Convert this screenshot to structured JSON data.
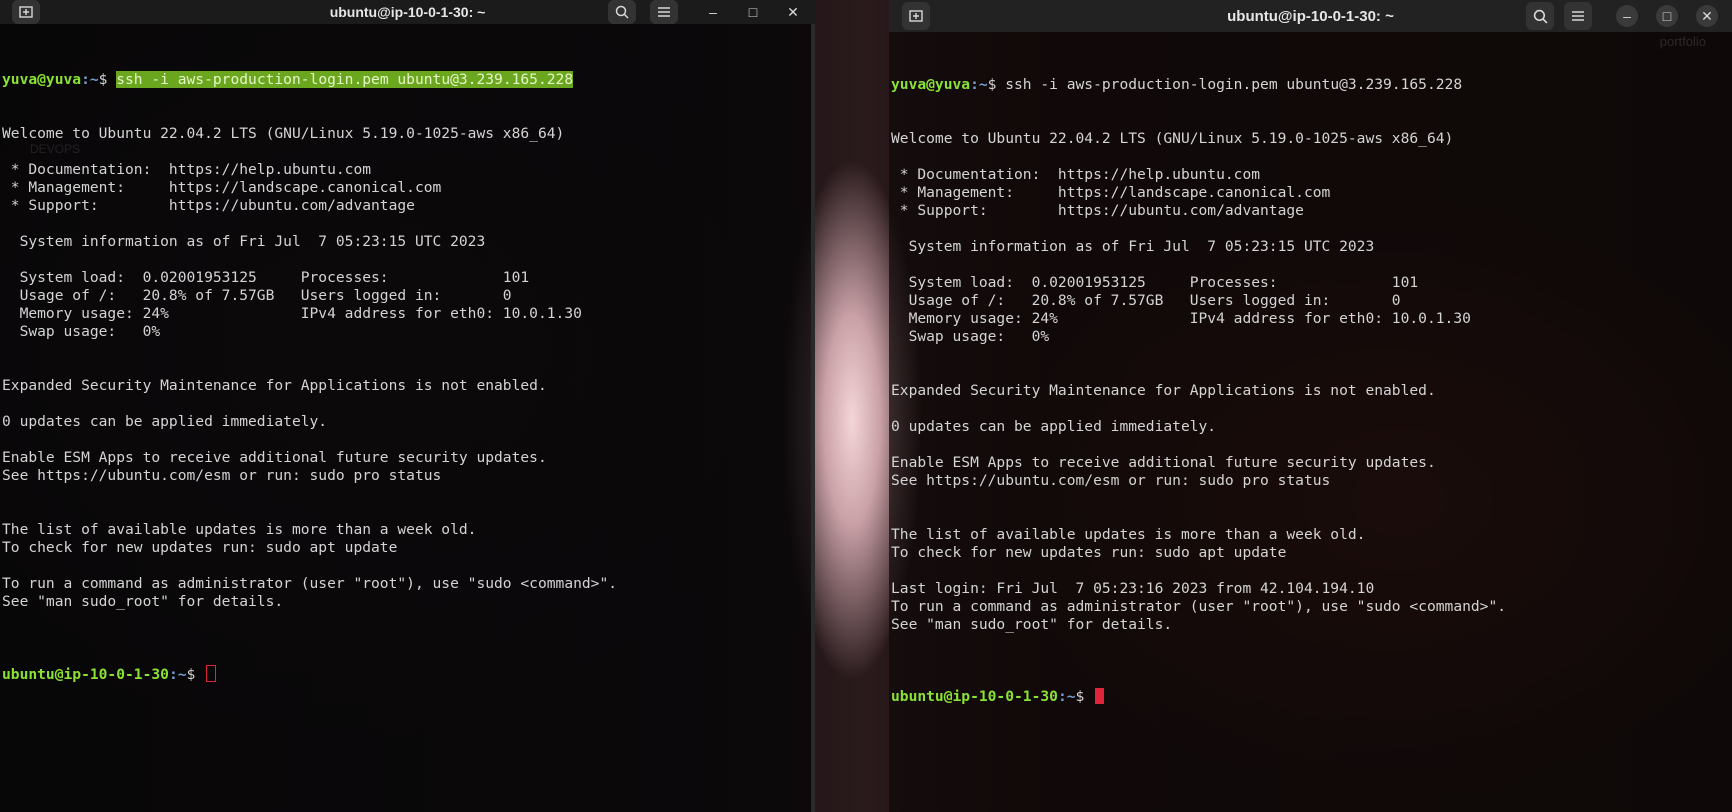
{
  "left_terminal": {
    "title": "ubuntu@ip-10-0-1-30: ~",
    "buttons": {
      "new_tab_icon": "new-tab-icon",
      "search_icon": "search-icon",
      "menu_icon": "hamburger-menu-icon",
      "minimize": "–",
      "maximize": "□",
      "close": "✕"
    },
    "watermark": "DEVOPS",
    "prompt_local_user": "yuva@yuva",
    "prompt_local_path": ":~",
    "prompt_local_symbol": "$ ",
    "command": "ssh -i aws-production-login.pem ubuntu@3.239.165.228",
    "lines": [
      "Welcome to Ubuntu 22.04.2 LTS (GNU/Linux 5.19.0-1025-aws x86_64)",
      "",
      " * Documentation:  https://help.ubuntu.com",
      " * Management:     https://landscape.canonical.com",
      " * Support:        https://ubuntu.com/advantage",
      "",
      "  System information as of Fri Jul  7 05:23:15 UTC 2023",
      "",
      "  System load:  0.02001953125     Processes:             101",
      "  Usage of /:   20.8% of 7.57GB   Users logged in:       0",
      "  Memory usage: 24%               IPv4 address for eth0: 10.0.1.30",
      "  Swap usage:   0%",
      "",
      "",
      "Expanded Security Maintenance for Applications is not enabled.",
      "",
      "0 updates can be applied immediately.",
      "",
      "Enable ESM Apps to receive additional future security updates.",
      "See https://ubuntu.com/esm or run: sudo pro status",
      "",
      "",
      "The list of available updates is more than a week old.",
      "To check for new updates run: sudo apt update",
      "",
      "To run a command as administrator (user \"root\"), use \"sudo <command>\".",
      "See \"man sudo_root\" for details.",
      ""
    ],
    "prompt_remote_user": "ubuntu@ip-10-0-1-30",
    "prompt_remote_path": ":~",
    "prompt_remote_symbol": "$ "
  },
  "right_terminal": {
    "title": "ubuntu@ip-10-0-1-30: ~",
    "buttons": {
      "new_tab_icon": "new-tab-icon",
      "search_icon": "search-icon",
      "menu_icon": "hamburger-menu-icon",
      "minimize": "–",
      "maximize": "□",
      "close": "✕"
    },
    "watermark": "portfolio",
    "prompt_local_user": "yuva@yuva",
    "prompt_local_path": ":~",
    "prompt_local_symbol": "$ ",
    "command": "ssh -i aws-production-login.pem ubuntu@3.239.165.228",
    "lines": [
      "Welcome to Ubuntu 22.04.2 LTS (GNU/Linux 5.19.0-1025-aws x86_64)",
      "",
      " * Documentation:  https://help.ubuntu.com",
      " * Management:     https://landscape.canonical.com",
      " * Support:        https://ubuntu.com/advantage",
      "",
      "  System information as of Fri Jul  7 05:23:15 UTC 2023",
      "",
      "  System load:  0.02001953125     Processes:             101",
      "  Usage of /:   20.8% of 7.57GB   Users logged in:       0",
      "  Memory usage: 24%               IPv4 address for eth0: 10.0.1.30",
      "  Swap usage:   0%",
      "",
      "",
      "Expanded Security Maintenance for Applications is not enabled.",
      "",
      "0 updates can be applied immediately.",
      "",
      "Enable ESM Apps to receive additional future security updates.",
      "See https://ubuntu.com/esm or run: sudo pro status",
      "",
      "",
      "The list of available updates is more than a week old.",
      "To check for new updates run: sudo apt update",
      "",
      "Last login: Fri Jul  7 05:23:16 2023 from 42.104.194.10",
      "To run a command as administrator (user \"root\"), use \"sudo <command>\".",
      "See \"man sudo_root\" for details.",
      ""
    ],
    "prompt_remote_user": "ubuntu@ip-10-0-1-30",
    "prompt_remote_path": ":~",
    "prompt_remote_symbol": "$ "
  },
  "colors": {
    "prompt_user": "#8ae234",
    "prompt_path": "#729fcf",
    "text": "#d4d4d4",
    "selection": "#6aa71f",
    "cursor": "#e0243c"
  }
}
